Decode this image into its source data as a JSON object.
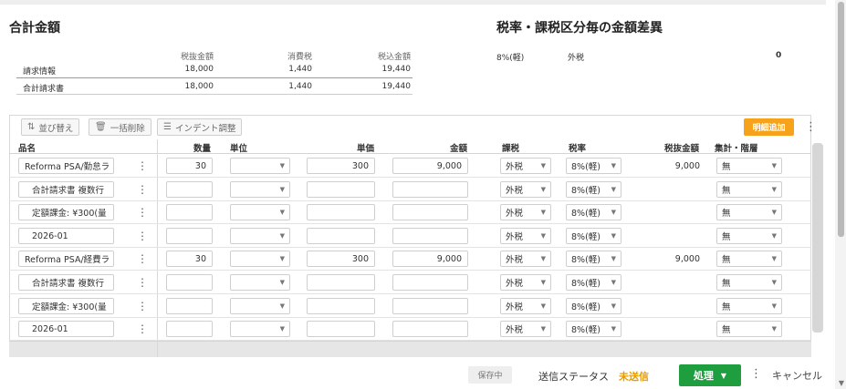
{
  "summary": {
    "title": "合計金額",
    "headers": [
      "税抜金額",
      "消費税",
      "税込金額"
    ],
    "rows": [
      {
        "label": "請求情報",
        "values": [
          "18,000",
          "1,440",
          "19,440"
        ]
      },
      {
        "label": "合計請求書",
        "values": [
          "18,000",
          "1,440",
          "19,440"
        ]
      }
    ]
  },
  "tax_diff": {
    "title": "税率・課税区分毎の金額差異",
    "rate": "8%(軽)",
    "type": "外税",
    "amount": "0"
  },
  "toolbar": {
    "sort": "並び替え",
    "bulk_delete": "一括削除",
    "indent": "インデント調整",
    "add_detail": "明細追加"
  },
  "columns": [
    "品名",
    "数量",
    "単位",
    "単価",
    "金額",
    "課税",
    "税率",
    "税抜金額",
    "集計・階層"
  ],
  "rows": [
    {
      "name": "Reforma PSA/勤怠ラ",
      "indent": false,
      "qty": "30",
      "unit": "",
      "price": "300",
      "amount": "9,000",
      "tax": "外税",
      "rate": "8%(軽)",
      "net": "9,000",
      "agg": "無"
    },
    {
      "name": "合計請求書 複数行",
      "indent": true,
      "qty": "",
      "unit": "",
      "price": "",
      "amount": "",
      "tax": "外税",
      "rate": "8%(軽)",
      "net": "",
      "agg": "無"
    },
    {
      "name": "定額課金: ¥300(量",
      "indent": true,
      "qty": "",
      "unit": "",
      "price": "",
      "amount": "",
      "tax": "外税",
      "rate": "8%(軽)",
      "net": "",
      "agg": "無"
    },
    {
      "name": "2026-01",
      "indent": true,
      "qty": "",
      "unit": "",
      "price": "",
      "amount": "",
      "tax": "外税",
      "rate": "8%(軽)",
      "net": "",
      "agg": "無"
    },
    {
      "name": "Reforma PSA/経費ラ",
      "indent": false,
      "qty": "30",
      "unit": "",
      "price": "300",
      "amount": "9,000",
      "tax": "外税",
      "rate": "8%(軽)",
      "net": "9,000",
      "agg": "無"
    },
    {
      "name": "合計請求書 複数行",
      "indent": true,
      "qty": "",
      "unit": "",
      "price": "",
      "amount": "",
      "tax": "外税",
      "rate": "8%(軽)",
      "net": "",
      "agg": "無"
    },
    {
      "name": "定額課金: ¥300(量",
      "indent": true,
      "qty": "",
      "unit": "",
      "price": "",
      "amount": "",
      "tax": "外税",
      "rate": "8%(軽)",
      "net": "",
      "agg": "無"
    },
    {
      "name": "2026-01",
      "indent": true,
      "qty": "",
      "unit": "",
      "price": "",
      "amount": "",
      "tax": "外税",
      "rate": "8%(軽)",
      "net": "",
      "agg": "無"
    }
  ],
  "footer": {
    "saving": "保存中",
    "status_label": "送信ステータス",
    "status_value": "未送信",
    "process": "処理",
    "cancel": "キャンセル"
  },
  "colors": {
    "accent_orange": "#f7a21b",
    "status_orange": "#e89b00",
    "process_green": "#1e9e3f"
  }
}
